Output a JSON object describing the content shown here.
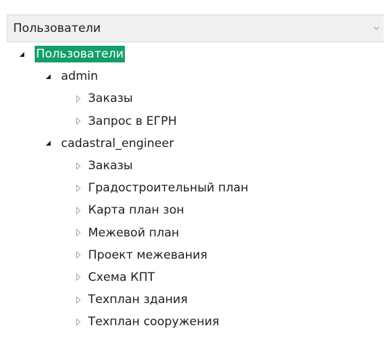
{
  "combo": {
    "value": "Пользователи",
    "arrow_icon": "chevron-down-icon"
  },
  "tree": {
    "root": {
      "label": "Пользователи",
      "expanded": true,
      "selected": true
    },
    "users": [
      {
        "label": "admin",
        "expanded": true,
        "items": [
          "Заказы",
          "Запрос в ЕГРН"
        ]
      },
      {
        "label": "cadastral_engineer",
        "expanded": true,
        "items": [
          "Заказы",
          "Градостроительный план",
          "Карта план зон",
          "Межевой план",
          "Проект межевания",
          "Схема КПТ",
          "Техплан здания",
          "Техплан сооружения"
        ]
      }
    ]
  },
  "colors": {
    "selection": "#139e6a",
    "expanded_arrow": "#1f1f1f",
    "collapsed_arrow": "#a5a5a5",
    "combo_background": "#f0f0f0"
  }
}
